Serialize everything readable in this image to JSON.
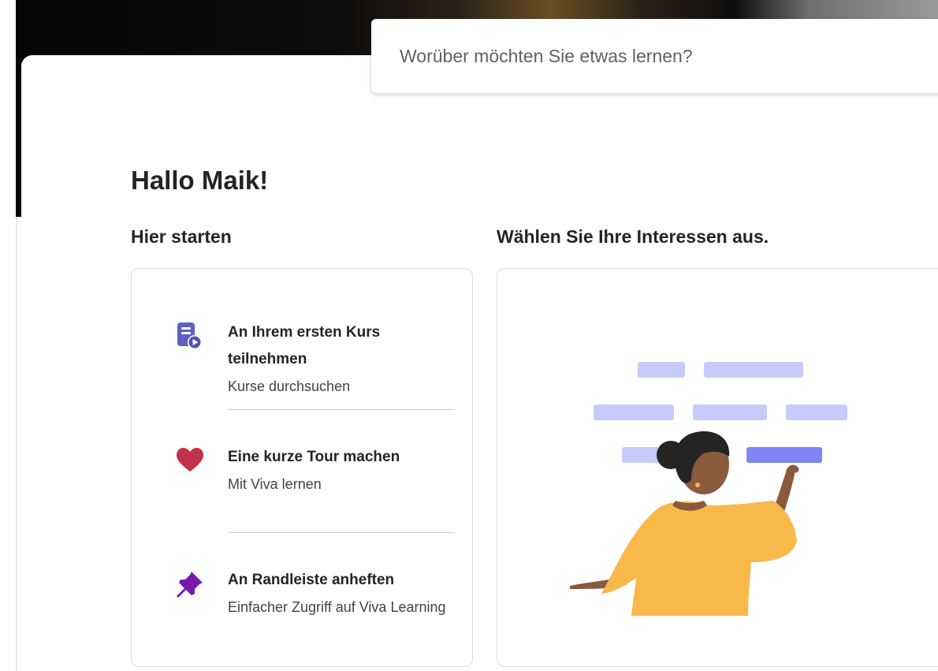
{
  "search": {
    "placeholder": "Worüber möchten Sie etwas lernen?"
  },
  "greeting": "Hallo Maik!",
  "start_section": {
    "title": "Hier starten",
    "items": [
      {
        "icon": "course-play-icon",
        "icon_color": "#5b5fc7",
        "title": "An Ihrem ersten Kurs teilnehmen",
        "subtitle": "Kurse durchsuchen"
      },
      {
        "icon": "heart-icon",
        "icon_color": "#c4314b",
        "title": "Eine kurze Tour machen",
        "subtitle": "Mit Viva lernen"
      },
      {
        "icon": "pin-icon",
        "icon_color": "#7719aa",
        "title": "An Randleiste anheften",
        "subtitle": "Einfacher Zugriff auf Viva Learning"
      }
    ]
  },
  "interests_section": {
    "title": "Wählen Sie Ihre Interessen aus."
  },
  "colors": {
    "chip_light": "#c5cbfa",
    "chip_selected": "#7f85f5",
    "figure_shirt": "#f8b84a",
    "figure_skin": "#8a5a3c",
    "figure_hair": "#242424"
  }
}
